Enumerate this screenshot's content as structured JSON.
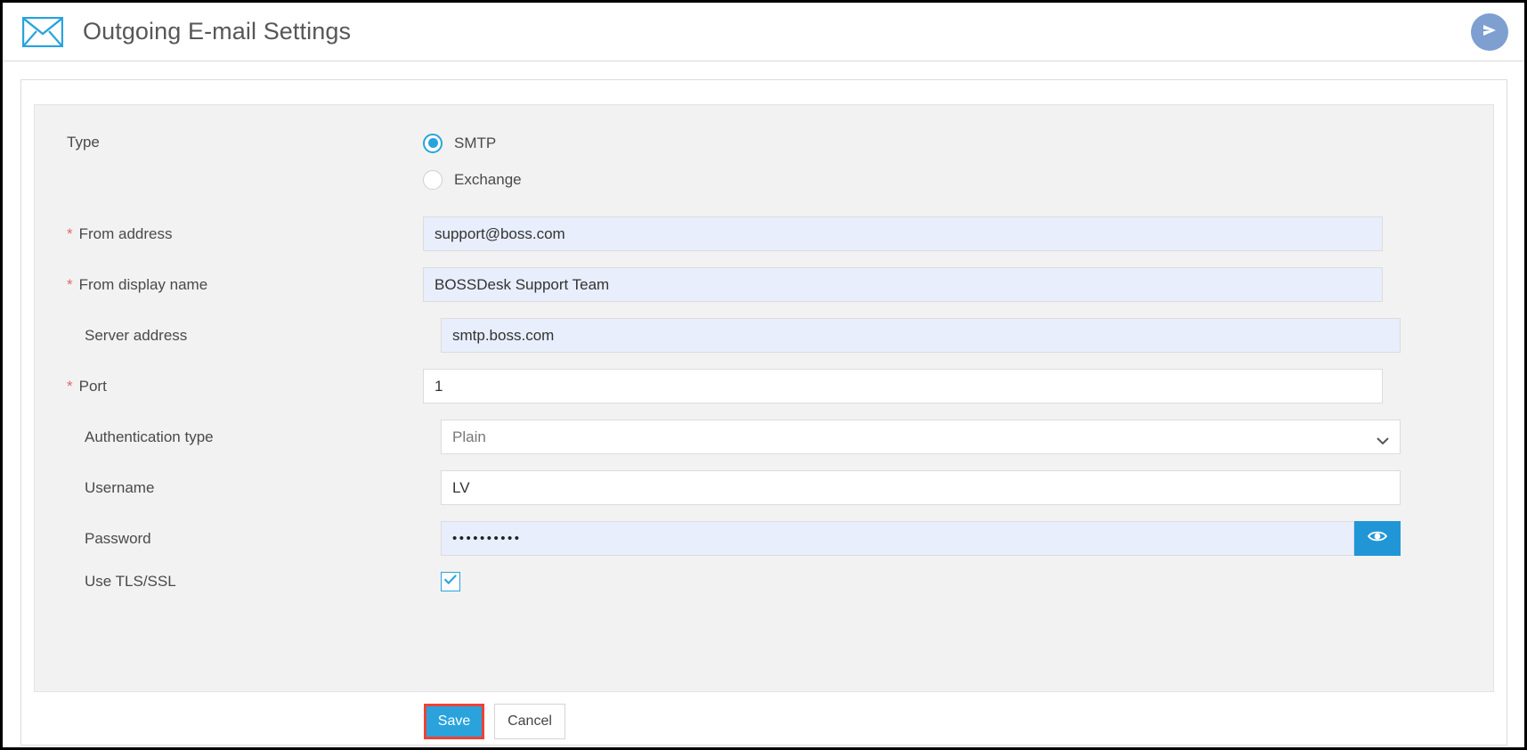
{
  "header": {
    "title": "Outgoing E-mail Settings",
    "mail_icon": "envelope-icon",
    "send_icon": "send-arrow-icon"
  },
  "form": {
    "type": {
      "label": "Type",
      "options": [
        {
          "label": "SMTP",
          "selected": true
        },
        {
          "label": "Exchange",
          "selected": false
        }
      ]
    },
    "fields": [
      {
        "label": "From address",
        "required": true,
        "value": "support@boss.com",
        "filled": true,
        "kind": "text"
      },
      {
        "label": "From display name",
        "required": true,
        "value": "BOSSDesk Support Team",
        "filled": true,
        "kind": "text"
      },
      {
        "label": "Server address",
        "required": false,
        "value": "smtp.boss.com",
        "filled": true,
        "kind": "text"
      },
      {
        "label": "Port",
        "required": true,
        "value": "1",
        "filled": false,
        "kind": "text"
      },
      {
        "label": "Authentication type",
        "required": false,
        "value": "Plain",
        "filled": false,
        "kind": "select",
        "options": [
          "Plain"
        ]
      },
      {
        "label": "Username",
        "required": false,
        "value": "LV",
        "filled": false,
        "kind": "text"
      },
      {
        "label": "Password",
        "required": false,
        "value": "••••••••••",
        "filled": true,
        "kind": "password",
        "reveal_icon": "eye-icon"
      },
      {
        "label": "Use TLS/SSL",
        "required": false,
        "checked": true,
        "kind": "checkbox",
        "check_icon": "checkmark-icon"
      }
    ]
  },
  "footer": {
    "save_label": "Save",
    "cancel_label": "Cancel"
  },
  "colors": {
    "accent": "#2aa3dd",
    "highlight": "#ef4136",
    "filled_field": "#e8eefb",
    "required_star": "#e06a6a",
    "send_button": "#7e9fd0",
    "panel": "#f2f2f2"
  }
}
